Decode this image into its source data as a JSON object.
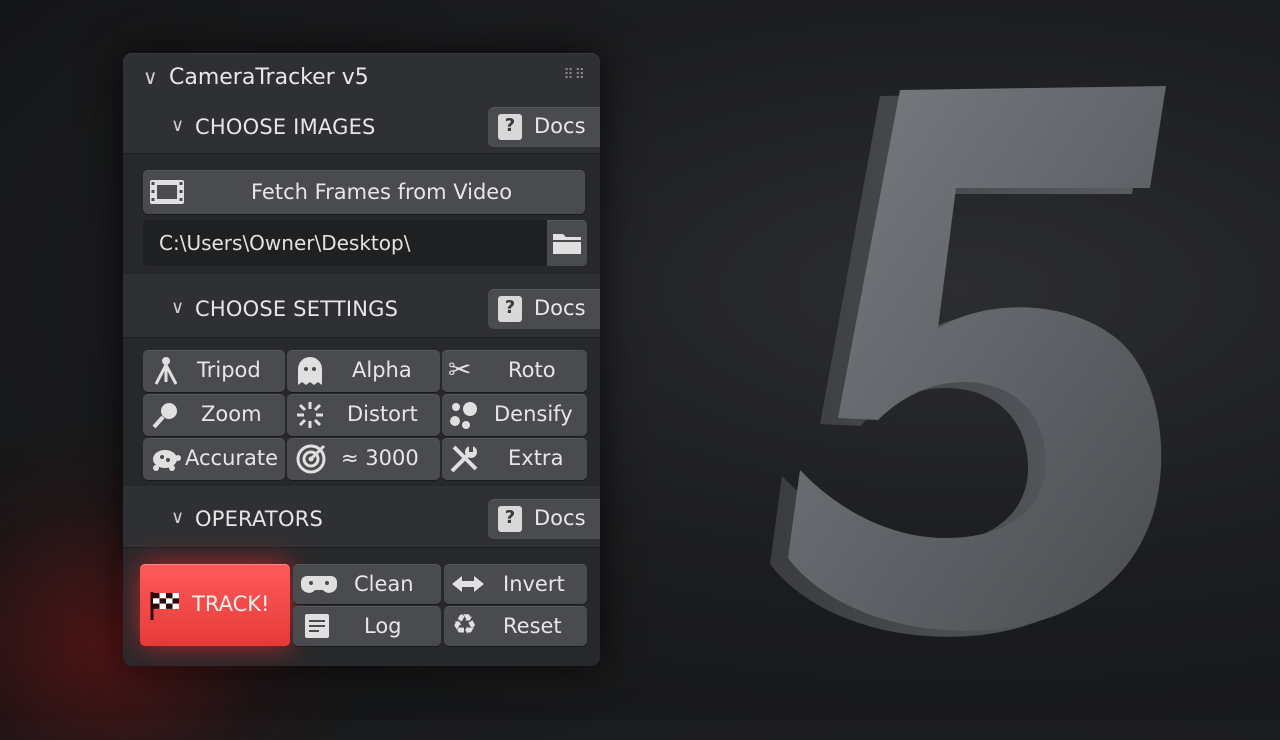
{
  "panel": {
    "title": "CameraTracker v5",
    "grip_icon": "drag-grip-icon"
  },
  "sections": {
    "images": {
      "label": "CHOOSE IMAGES",
      "docs_label": "Docs",
      "fetch_label": "Fetch Frames from Video",
      "path_value": "C:\\Users\\Owner\\Desktop\\"
    },
    "settings": {
      "label": "CHOOSE SETTINGS",
      "docs_label": "Docs",
      "buttons": [
        {
          "label": "Tripod",
          "icon": "tripod-icon"
        },
        {
          "label": "Alpha",
          "icon": "ghost-icon"
        },
        {
          "label": "Roto",
          "icon": "scissors-icon"
        },
        {
          "label": "Zoom",
          "icon": "magnifier-icon"
        },
        {
          "label": "Distort",
          "icon": "burst-icon"
        },
        {
          "label": "Densify",
          "icon": "dots-icon"
        },
        {
          "label": "Accurate",
          "icon": "turtle-icon"
        },
        {
          "label": "≈ 3000",
          "icon": "target-icon"
        },
        {
          "label": "Extra",
          "icon": "tools-icon"
        }
      ]
    },
    "operators": {
      "label": "OPERATORS",
      "docs_label": "Docs",
      "track_label": "TRACK!",
      "buttons": [
        {
          "label": "Clean",
          "icon": "gamepad-icon"
        },
        {
          "label": "Invert",
          "icon": "arrows-icon"
        },
        {
          "label": "Log",
          "icon": "log-icon"
        },
        {
          "label": "Reset",
          "icon": "recycle-icon"
        }
      ]
    }
  },
  "colors": {
    "accent_track": "#ef4444",
    "panel_bg": "#2f3033",
    "button_bg": "#4a4b4f"
  },
  "hero_glyph": "5"
}
